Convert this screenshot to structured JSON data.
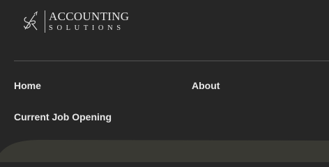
{
  "brand": {
    "line1": "ACCOUNTING",
    "line2": "SOLUTIONS"
  },
  "nav": {
    "home": "Home",
    "about": "About",
    "jobs": "Current Job Opening"
  },
  "colors": {
    "background": "#262626",
    "hero": "#393933",
    "text": "#e8e8e8",
    "divider": "#555555"
  }
}
